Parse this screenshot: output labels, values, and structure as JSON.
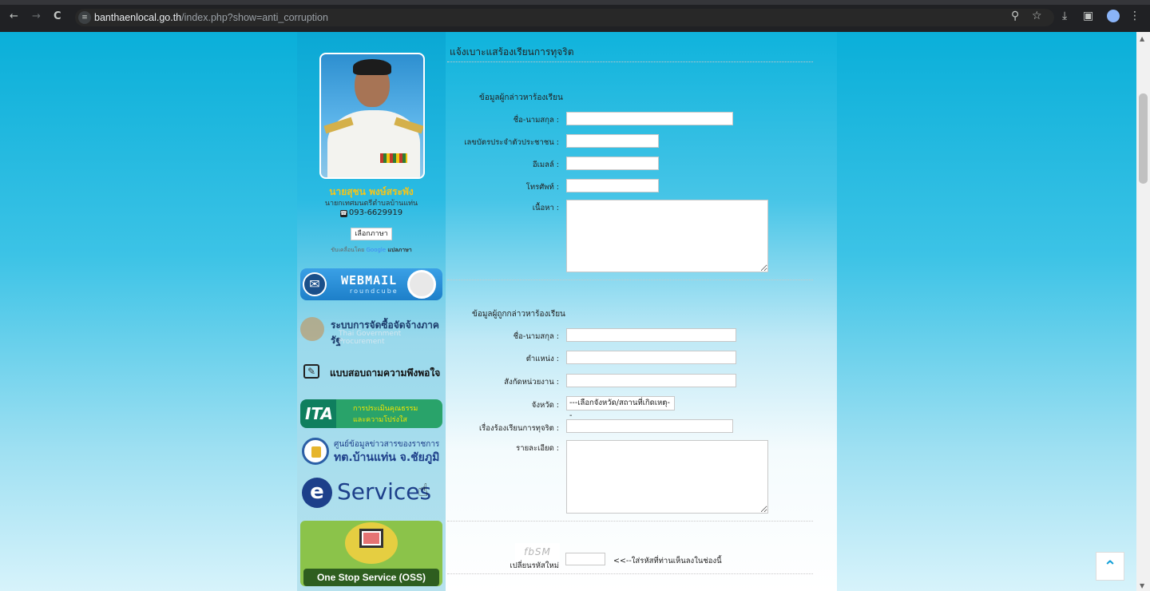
{
  "browser": {
    "url_host": "banthaenlocal.go.th",
    "url_path": "/index.php?show=anti_corruption",
    "site_info_icon": "tune-icon",
    "nav": {
      "back": "←",
      "forward": "→",
      "reload": "C"
    },
    "toolbar_icons": {
      "zoom": "⚲",
      "star": "☆",
      "download": "⤓",
      "sidebar": "▣",
      "menu": "⋮"
    }
  },
  "profile": {
    "name": "นายสุชน พงษ์สระพัง",
    "title": "นายกเทศมนตรีตำบลบ้านแท่น",
    "phone": "093-6629919",
    "lang_button": "เลือกภาษา",
    "powered_prefix": "ขับเคลื่อนโดย",
    "powered_google": "Google",
    "powered_suffix": "แปลภาษา"
  },
  "banners": {
    "webmail_title": "WEBMAIL",
    "webmail_sub": "roundcube",
    "egp_title": "ระบบการจัดซื้อจัดจ้างภาครัฐ",
    "egp_sub": "Thai Government Procurement",
    "survey": "แบบสอบถามความพึงพอใจ",
    "ita_logo": "ITA",
    "ita_line1": "การประเมินคุณธรรม",
    "ita_line2": "และความโปร่งใส",
    "oic_line1": "ศูนย์ข้อมูลข่าวสารของราชการ",
    "oic_line2": "ทต.บ้านแท่น จ.ชัยภูมิ",
    "eservices_e": "e",
    "eservices": "Services",
    "oss": "One Stop Service (OSS)"
  },
  "form": {
    "page_title": "แจ้งเบาะแสร้องเรียนการทุจริต",
    "complainant_heading": "ข้อมูลผู้กล่าวหาร้องเรียน",
    "complainant": {
      "name_label": "ชื่อ-นามสกุล :",
      "id_label": "เลขบัตรประจำตัวประชาชน :",
      "email_label": "อีเมลล์ :",
      "phone_label": "โทรศัพท์ :",
      "content_label": "เนื้อหา :"
    },
    "accused_heading": "ข้อมูลผู้ถูกกล่าวหาร้องเรียน",
    "accused": {
      "name_label": "ชื่อ-นามสกุล :",
      "position_label": "ตำแหน่ง :",
      "agency_label": "สังกัดหน่วยงาน :",
      "province_label": "จังหวัด :",
      "province_selected": "---เลือกจังหวัด/สถานที่เกิดเหตุ--",
      "subject_label": "เรื่องร้องเรียนการทุจริต :",
      "detail_label": "รายละเอียด :"
    },
    "captcha_text": "fbSM",
    "captcha_refresh": "เปลี่ยนรหัสใหม่",
    "captcha_hint": "<<--ใส่รหัสที่ท่านเห็นลงในช่องนี้"
  },
  "scroll_top_icon": "double-chevron-up-icon"
}
